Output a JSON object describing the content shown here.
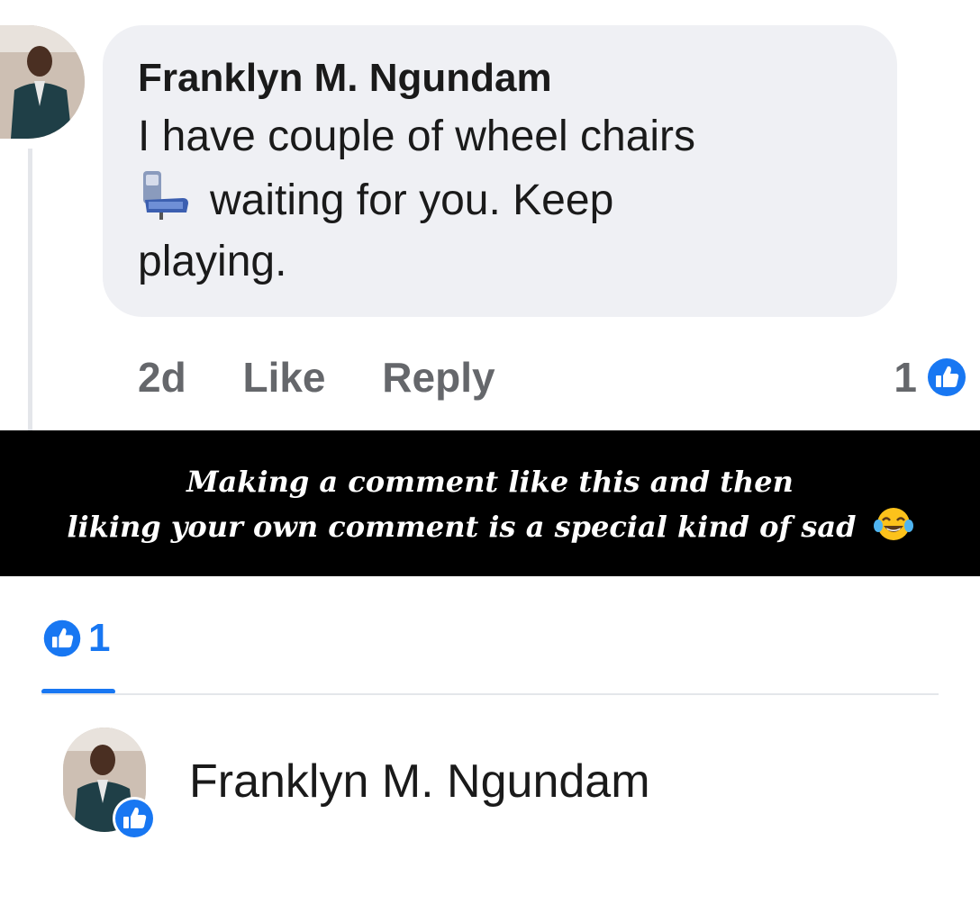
{
  "comment": {
    "author": "Franklyn M. Ngundam",
    "text_line1": "I have couple of wheel chairs",
    "text_line2": "waiting for you.  Keep",
    "text_line3": "playing.",
    "emoji_icon": "seat-icon",
    "time": "2d",
    "like_label": "Like",
    "reply_label": "Reply",
    "like_count": "1"
  },
  "caption": {
    "line1": "Making a comment like this and then",
    "line2": "liking your own comment is a special kind of sad",
    "emoji": "tears-of-joy-emoji"
  },
  "reactions": {
    "tab_count": "1",
    "people": [
      {
        "name": "Franklyn M. Ngundam",
        "reaction": "like"
      }
    ]
  },
  "colors": {
    "accent_blue": "#1877f2",
    "bubble_bg": "#eff0f4",
    "meta_gray": "#65676b"
  }
}
